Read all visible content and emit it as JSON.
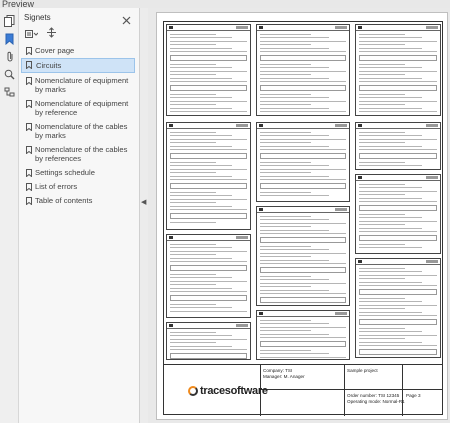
{
  "window": {
    "title": "Preview"
  },
  "panel": {
    "title": "Signets",
    "close_icon": "close-icon",
    "items": [
      {
        "label": "Cover page",
        "selected": false
      },
      {
        "label": "Circuits",
        "selected": true
      },
      {
        "label": "Nomenclature of equipment by marks",
        "selected": false
      },
      {
        "label": "Nomenclature of equipment by reference",
        "selected": false
      },
      {
        "label": "Nomenclature of the cables by marks",
        "selected": false
      },
      {
        "label": "Nomenclature of the cables by references",
        "selected": false
      },
      {
        "label": "Settings schedule",
        "selected": false
      },
      {
        "label": "List of errors",
        "selected": false
      },
      {
        "label": "Table of contents",
        "selected": false
      }
    ]
  },
  "titleblock": {
    "company": "Company: TSI",
    "manager": "Manager: M. Anager",
    "project": "Sample project",
    "order": "Order number: TSI 12345",
    "operating": "Operating mode: Normal-R1",
    "page": "Page 3",
    "logo_text": "tracesoftware",
    "accent": "#f08a1c"
  },
  "colors": {
    "selection": "#cfe3f7",
    "selection_border": "#9cc4ea"
  }
}
